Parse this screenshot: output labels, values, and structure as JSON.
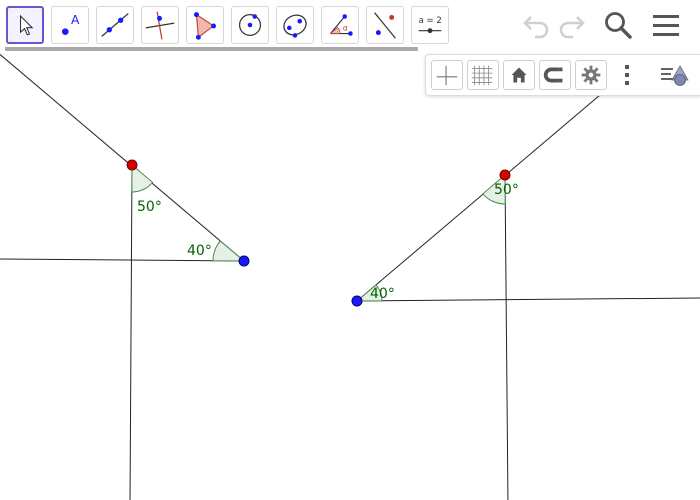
{
  "toolbar": {
    "tools": [
      {
        "name": "move-tool",
        "selected": true
      },
      {
        "name": "point-tool",
        "label": "A"
      },
      {
        "name": "line-tool"
      },
      {
        "name": "perpendicular-line-tool"
      },
      {
        "name": "polygon-tool"
      },
      {
        "name": "circle-tool"
      },
      {
        "name": "conic-tool"
      },
      {
        "name": "angle-tool",
        "label": "α"
      },
      {
        "name": "reflect-tool"
      },
      {
        "name": "slider-tool",
        "label": "a = 2"
      }
    ],
    "right": [
      "undo-icon",
      "redo-icon",
      "search-icon",
      "menu-icon"
    ]
  },
  "style_bar": {
    "buttons": [
      "axes-toggle",
      "grid-toggle",
      "standard-view",
      "point-capturing",
      "graphics-settings",
      "more-options",
      "toggle-style-bar"
    ]
  },
  "colors": {
    "accent": "#6557d2",
    "point_red": "#d40000",
    "point_blue": "#1a1aff",
    "angle_fill": "#e6f0e6",
    "angle_text": "#006400",
    "line": "#222222"
  },
  "angles": {
    "left_top": "50°",
    "left_right": "40°",
    "right_top": "50°",
    "right_left": "40°"
  }
}
